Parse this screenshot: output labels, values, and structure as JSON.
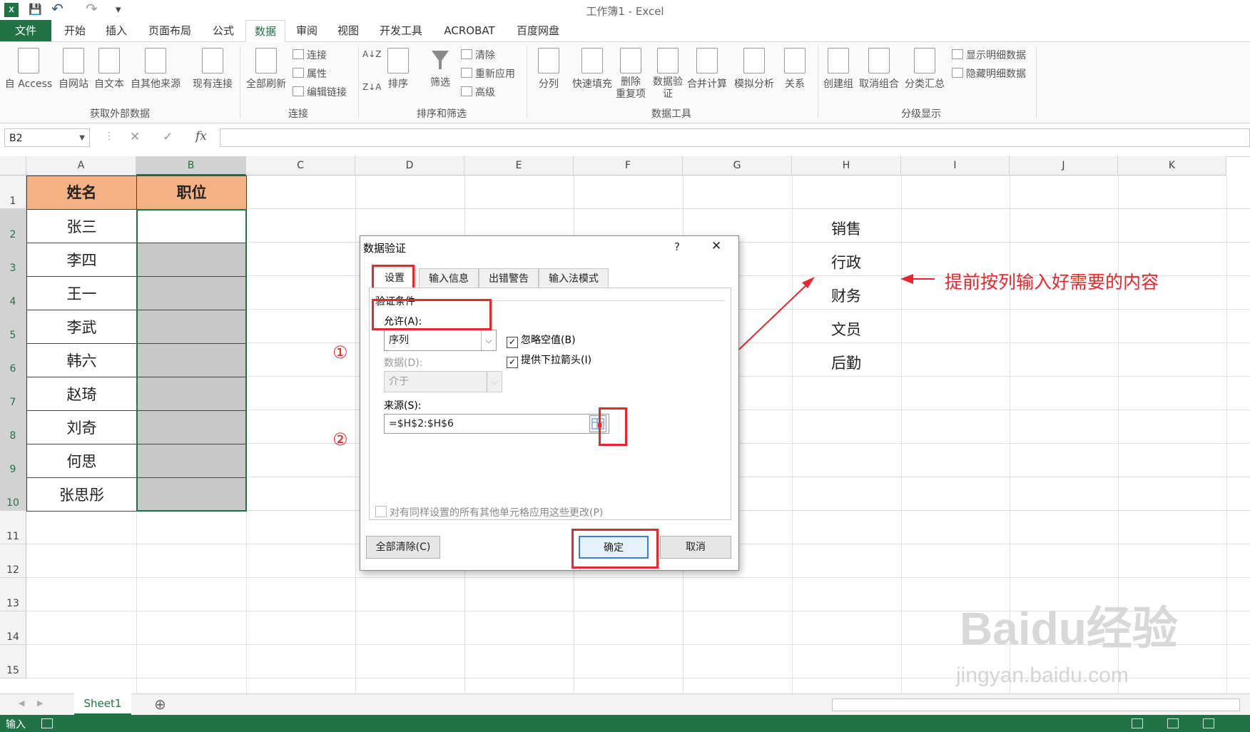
{
  "window": {
    "title": "工作簿1 - Excel",
    "app_icon": "X"
  },
  "quick_access": {
    "save": "💾",
    "undo": "↶",
    "redo": "↷",
    "more": "▾"
  },
  "tabs": [
    "文件",
    "开始",
    "插入",
    "页面布局",
    "公式",
    "数据",
    "审阅",
    "视图",
    "开发工具",
    "ACROBAT",
    "百度网盘"
  ],
  "active_tab": "数据",
  "ribbon": {
    "external": {
      "items": [
        "自 Access",
        "自网站",
        "自文本",
        "自其他来源",
        "现有连接"
      ],
      "group": "获取外部数据"
    },
    "connections": {
      "refresh": "全部刷新",
      "small": [
        "连接",
        "属性",
        "编辑链接"
      ],
      "group": "连接"
    },
    "sort_filter": {
      "sort": "排序",
      "filter": "筛选",
      "small": [
        "清除",
        "重新应用",
        "高级"
      ],
      "az": "A↓Z",
      "za": "Z↓A",
      "group": "排序和筛选"
    },
    "data_tools": {
      "items": [
        "分列",
        "快速填充",
        "删除\n重复项",
        "数据验\n证",
        "合并计算",
        "模拟分析",
        "关系"
      ],
      "group": "数据工具"
    },
    "outline": {
      "items": [
        "创建组",
        "取消组合",
        "分类汇总"
      ],
      "small": [
        "显示明细数据",
        "隐藏明细数据"
      ],
      "group": "分级显示"
    }
  },
  "formula_bar": {
    "name_box": "B2",
    "cancel": "✕",
    "enter": "✓",
    "fx": "fx",
    "value": ""
  },
  "columns": [
    "A",
    "B",
    "C",
    "D",
    "E",
    "F",
    "G",
    "H",
    "I",
    "J",
    "K"
  ],
  "rows": [
    "1",
    "2",
    "3",
    "4",
    "5",
    "6",
    "7",
    "8",
    "9",
    "10",
    "11",
    "12",
    "13",
    "14",
    "15"
  ],
  "table": {
    "headers": [
      "姓名",
      "职位"
    ],
    "names": [
      "张三",
      "李四",
      "王一",
      "李武",
      "韩六",
      "赵琦",
      "刘奇",
      "何思",
      "张思彤"
    ]
  },
  "h_column": [
    "销售",
    "行政",
    "财务",
    "文员",
    "后勤"
  ],
  "dialog": {
    "title": "数据验证",
    "help": "?",
    "close": "✕",
    "tabs": [
      "设置",
      "输入信息",
      "出错警告",
      "输入法模式"
    ],
    "section": "验证条件",
    "allow_label": "允许(A):",
    "allow_value": "序列",
    "ignore_blank": "忽略空值(B)",
    "dropdown": "提供下拉箭头(I)",
    "data_label": "数据(D):",
    "data_value": "介于",
    "source_label": "来源(S):",
    "source_value": "=$H$2:$H$6",
    "apply_all": "对有同样设置的所有其他单元格应用这些更改(P)",
    "clear_all": "全部清除(C)",
    "ok": "确定",
    "cancel": "取消"
  },
  "markers": {
    "one": "①",
    "two": "②"
  },
  "annotation": "提前按列输入好需要的内容",
  "sheet": {
    "name": "Sheet1",
    "add": "⊕"
  },
  "status": {
    "mode": "输入"
  },
  "watermark": {
    "main": "Baidu经验",
    "sub": "jingyan.baidu.com"
  },
  "colors": {
    "excel_green": "#217346",
    "header_fill": "#f4b183",
    "selection_gray": "#c8c8c8",
    "annotation_red": "#e8262b"
  }
}
